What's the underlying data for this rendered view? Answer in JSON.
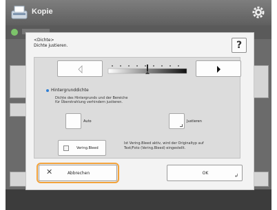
{
  "app": {
    "title": "Kopie",
    "icon": "copy-icon",
    "settings_icon": "gear-icon"
  },
  "dialog": {
    "title_line1": "<Dichte>",
    "title_line2": "Dichte justieren.",
    "help_label": "?",
    "density": {
      "lighter_icon": "lighter-icon",
      "darker_icon": "darker-icon",
      "level": 0.5
    },
    "background_section": {
      "heading": "Hintergrunddichte",
      "description_line1": "Dichte des Hintergrunds und der Bereiche",
      "description_line2": "für Überstrahlung verhindern justieren.",
      "auto_label": "Auto",
      "adjust_label": "Justieren"
    },
    "vering_bleed": {
      "label": "Vering.Bleed",
      "note_line1": "Ist Vering.Bleed aktiv, wird der Originaltyp auf",
      "note_line2": "Text/Foto (Vering.Bleed) eingestellt."
    },
    "cancel_label": "Abbrechen",
    "ok_label": "OK"
  },
  "colors": {
    "highlight": "#f2a23a",
    "accent": "#2f7fd4"
  }
}
